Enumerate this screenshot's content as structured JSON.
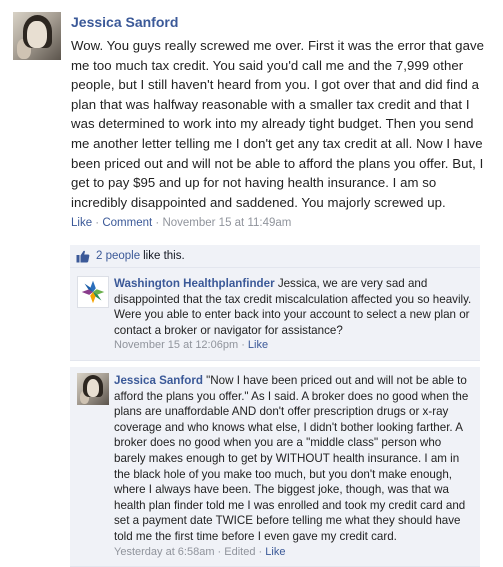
{
  "post": {
    "author": "Jessica Sanford",
    "text": "Wow. You guys really screwed me over. First it was the error that gave me too much tax credit. You said you'd call me and the 7,999 other people, but I still haven't heard from you. I got over that and did find a plan that was halfway reasonable with a smaller tax credit and that I was determined to work into my already tight budget. Then you send me another letter telling me I don't get any tax credit at all. Now I have been priced out and will not be able to afford the plans you offer. But, I get to pay $95 and up for not having health insurance. I am so incredibly disappointed and saddened. You majorly screwed up.",
    "like_label": "Like",
    "sep": " · ",
    "comment_label": "Comment",
    "timestamp": "November 15 at 11:49am"
  },
  "likes": {
    "count_label": "2 people",
    "suffix": " like this."
  },
  "comments": [
    {
      "author": "Washington Healthplanfinder",
      "text": " Jessica, we are very sad and disappointed that the tax credit miscalculation affected you so heavily. Were you able to enter back into your account to select a new plan or contact a broker or navigator for assistance?",
      "timestamp": "November 15 at 12:06pm",
      "sep": " · ",
      "like_label": "Like"
    },
    {
      "author": "Jessica Sanford",
      "text": " \"Now I have been priced out and will not be able to afford the plans you offer.\" As I said. A broker does no good when the plans are unaffordable AND don't offer prescription drugs or x-ray coverage and who knows what else, I didn't bother looking farther. A broker does no good when you are a \"middle class\" person who barely makes enough to get by WITHOUT health insurance. I am in the black hole of you make too much, but you don't make enough, where I always have been. The biggest joke, though, was that wa health plan finder told me I was enrolled and took my credit card and set a payment date TWICE before telling me what they should have told me the first time before I even gave my credit card.",
      "timestamp": "Yesterday at 6:58am",
      "sep": " · ",
      "edited_label": "Edited",
      "like_label": "Like"
    }
  ],
  "colors": {
    "link": "#3b5998",
    "meta": "#90949c",
    "comment_bg": "#f0f2f7"
  }
}
